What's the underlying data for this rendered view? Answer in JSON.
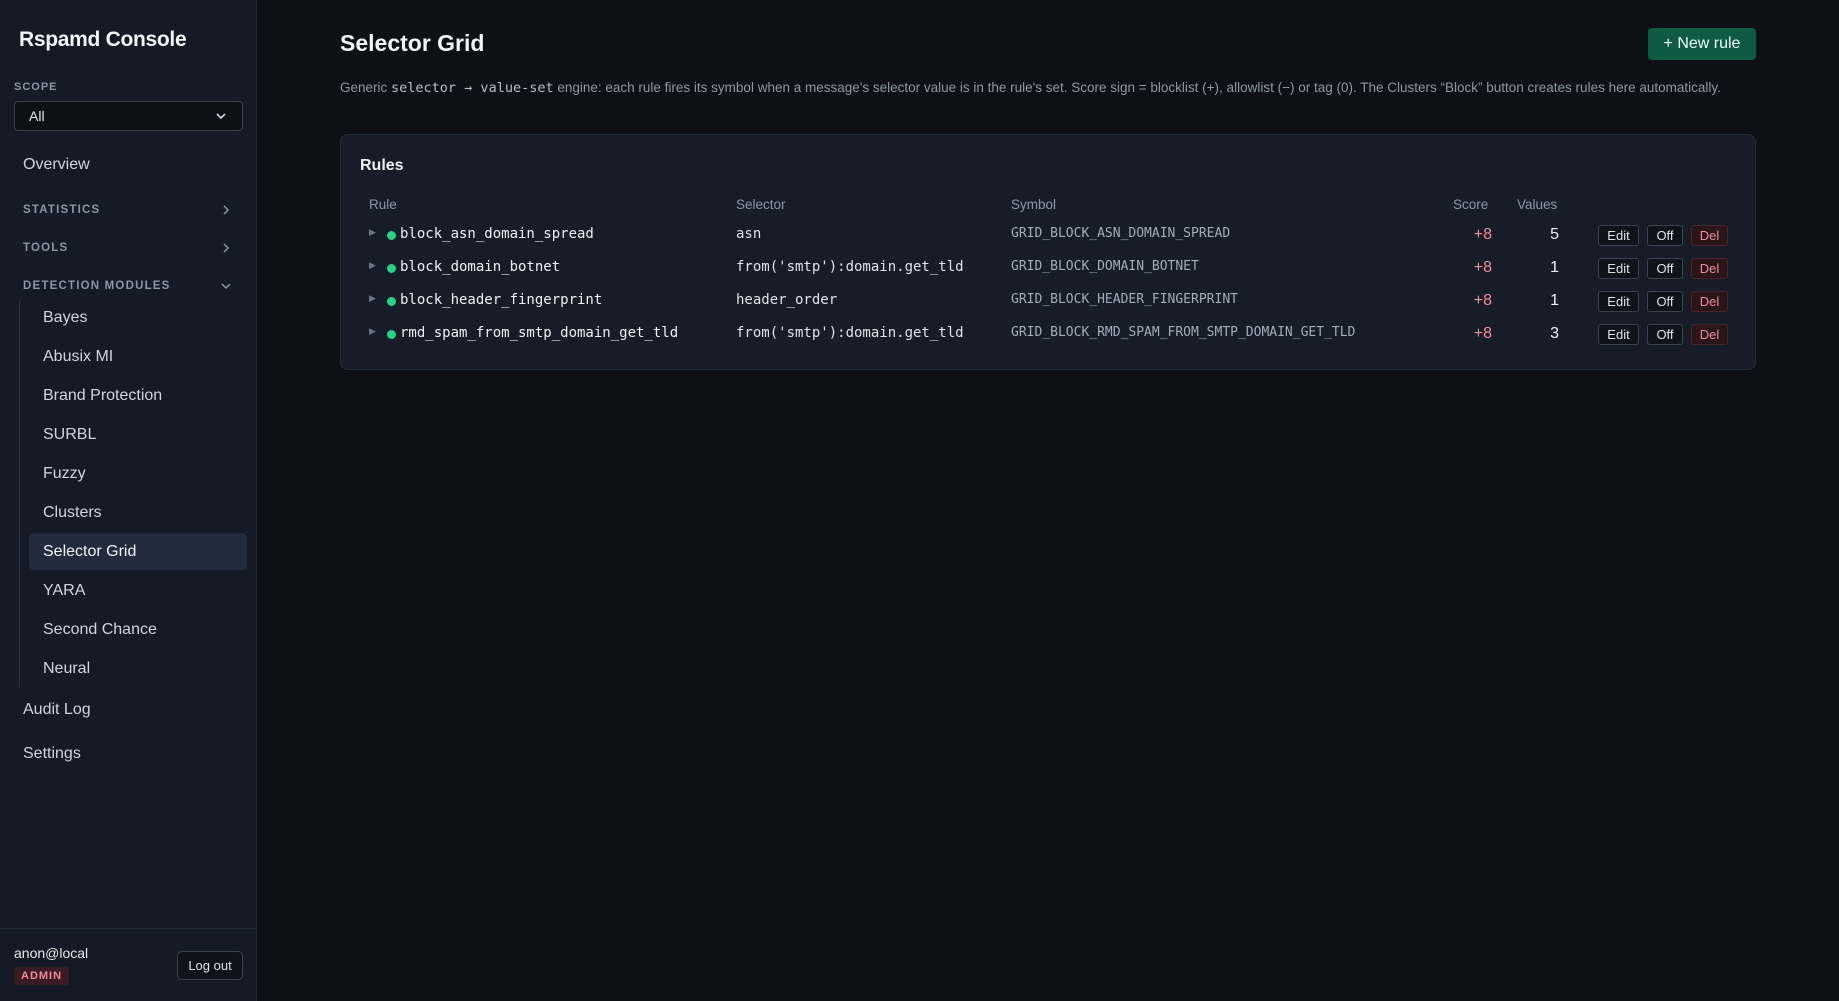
{
  "sidebar": {
    "brand": "Rspamd Console",
    "scope_label": "SCOPE",
    "scope_value": "All",
    "nav": {
      "overview": "Overview",
      "statistics": "STATISTICS",
      "tools": "TOOLS",
      "detection_modules": "DETECTION MODULES",
      "audit_log": "Audit Log",
      "settings": "Settings"
    },
    "modules": [
      "Bayes",
      "Abusix MI",
      "Brand Protection",
      "SURBL",
      "Fuzzy",
      "Clusters",
      "Selector Grid",
      "YARA",
      "Second Chance",
      "Neural"
    ],
    "active_module": "Selector Grid",
    "footer": {
      "user": "anon@local",
      "role": "ADMIN",
      "logout": "Log out"
    }
  },
  "main": {
    "title": "Selector Grid",
    "new_rule_label": "+ New rule",
    "description": {
      "prefix": "Generic ",
      "code": "selector → value-set",
      "suffix": " engine: each rule fires its symbol when a message's selector value is in the rule's set. Score sign = blocklist (+), allowlist (−) or tag (0). The Clusters “Block” button creates rules here automatically."
    },
    "rules_card": {
      "title": "Rules",
      "columns": {
        "rule": "Rule",
        "selector": "Selector",
        "symbol": "Symbol",
        "score": "Score",
        "values": "Values"
      },
      "actions": {
        "edit": "Edit",
        "off": "Off",
        "del": "Del"
      },
      "rows": [
        {
          "name": "block_asn_domain_spread",
          "selector": "asn",
          "symbol": "GRID_BLOCK_ASN_DOMAIN_SPREAD",
          "score": "+8",
          "values": "5",
          "enabled": true
        },
        {
          "name": "block_domain_botnet",
          "selector": "from('smtp'):domain.get_tld",
          "symbol": "GRID_BLOCK_DOMAIN_BOTNET",
          "score": "+8",
          "values": "1",
          "enabled": true
        },
        {
          "name": "block_header_fingerprint",
          "selector": "header_order",
          "symbol": "GRID_BLOCK_HEADER_FINGERPRINT",
          "score": "+8",
          "values": "1",
          "enabled": true
        },
        {
          "name": "rmd_spam_from_smtp_domain_get_tld",
          "selector": "from('smtp'):domain.get_tld",
          "symbol": "GRID_BLOCK_RMD_SPAM_FROM_SMTP_DOMAIN_GET_TLD",
          "score": "+8",
          "values": "3",
          "enabled": true
        }
      ]
    }
  },
  "colors": {
    "accent_green": "#0f5a45",
    "status_enabled": "#2ccf86",
    "score_positive": "#f08a99"
  },
  "icons": {
    "scope_dropdown": "chevron-down-icon",
    "statistics": "chevron-right-icon",
    "tools": "chevron-right-icon",
    "detection_modules": "chevron-down-icon",
    "row_expand": "triangle-right-icon",
    "row_status": "status-dot-icon"
  }
}
